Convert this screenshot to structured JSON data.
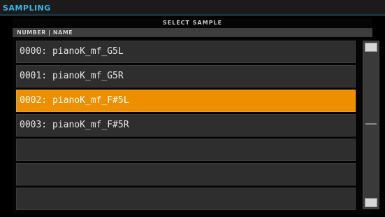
{
  "topbar": {
    "title": "SAMPLING"
  },
  "dialog": {
    "title": "SELECT SAMPLE",
    "column_header": "NUMBER | NAME"
  },
  "samples": [
    {
      "label": "0000: pianoK_mf_G5L",
      "selected": false
    },
    {
      "label": "0001: pianoK_mf_G5R",
      "selected": false
    },
    {
      "label": "0002: pianoK_mf_F#5L",
      "selected": true
    },
    {
      "label": "0003: pianoK_mf_F#5R",
      "selected": false
    },
    {
      "label": "",
      "selected": false
    },
    {
      "label": "",
      "selected": false
    },
    {
      "label": "",
      "selected": false
    }
  ],
  "colors": {
    "accent": "#38b8e8",
    "selected": "#ee8f00",
    "row_bg": "#2e2e2e"
  }
}
